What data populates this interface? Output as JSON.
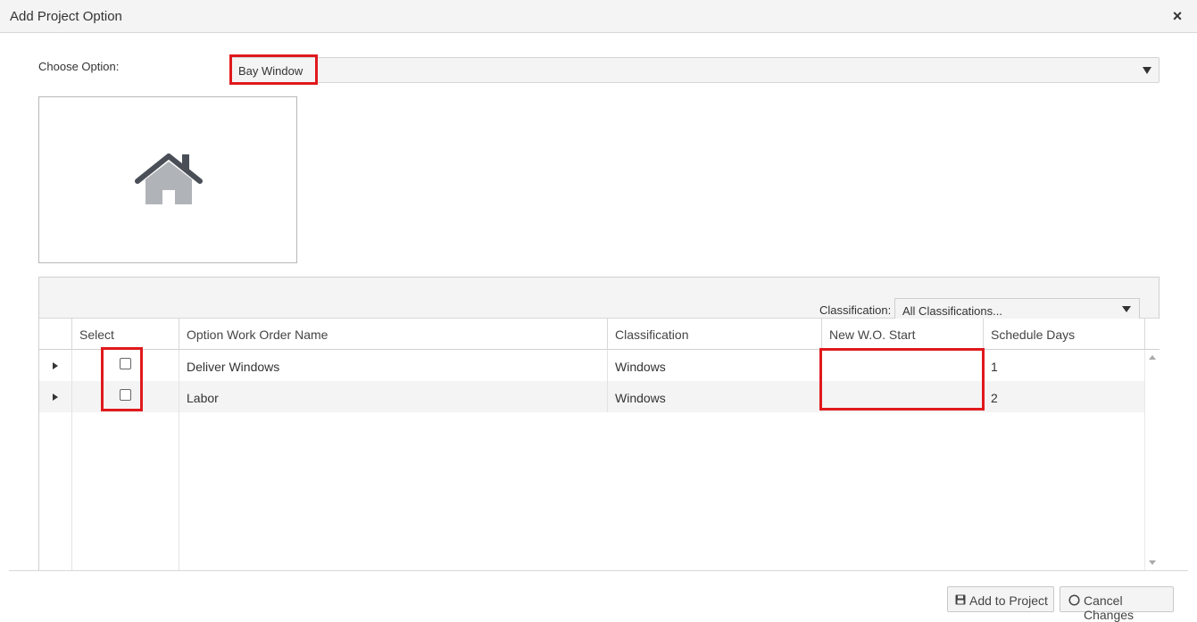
{
  "dialog": {
    "title": "Add Project Option",
    "close_label": "×"
  },
  "option": {
    "label": "Choose Option:",
    "selected": "Bay Window"
  },
  "image": {
    "icon": "house-icon"
  },
  "grid": {
    "classification_label": "Classification:",
    "classification_selected": "All Classifications...",
    "columns": [
      "Select",
      "Option Work Order Name",
      "Classification",
      "New W.O. Start",
      "Schedule Days"
    ],
    "rows": [
      {
        "name": "Deliver Windows",
        "classification": "Windows",
        "start": "",
        "days": "1"
      },
      {
        "name": "Labor",
        "classification": "Windows",
        "start": "",
        "days": "2"
      }
    ]
  },
  "footer": {
    "add_label": "Add to Project",
    "cancel_label": "Cancel Changes"
  },
  "colors": {
    "highlight": "#e0191d",
    "panel_bg": "#f4f4f4",
    "icon_dark": "#4a4f57",
    "icon_light": "#b0b3b8"
  }
}
